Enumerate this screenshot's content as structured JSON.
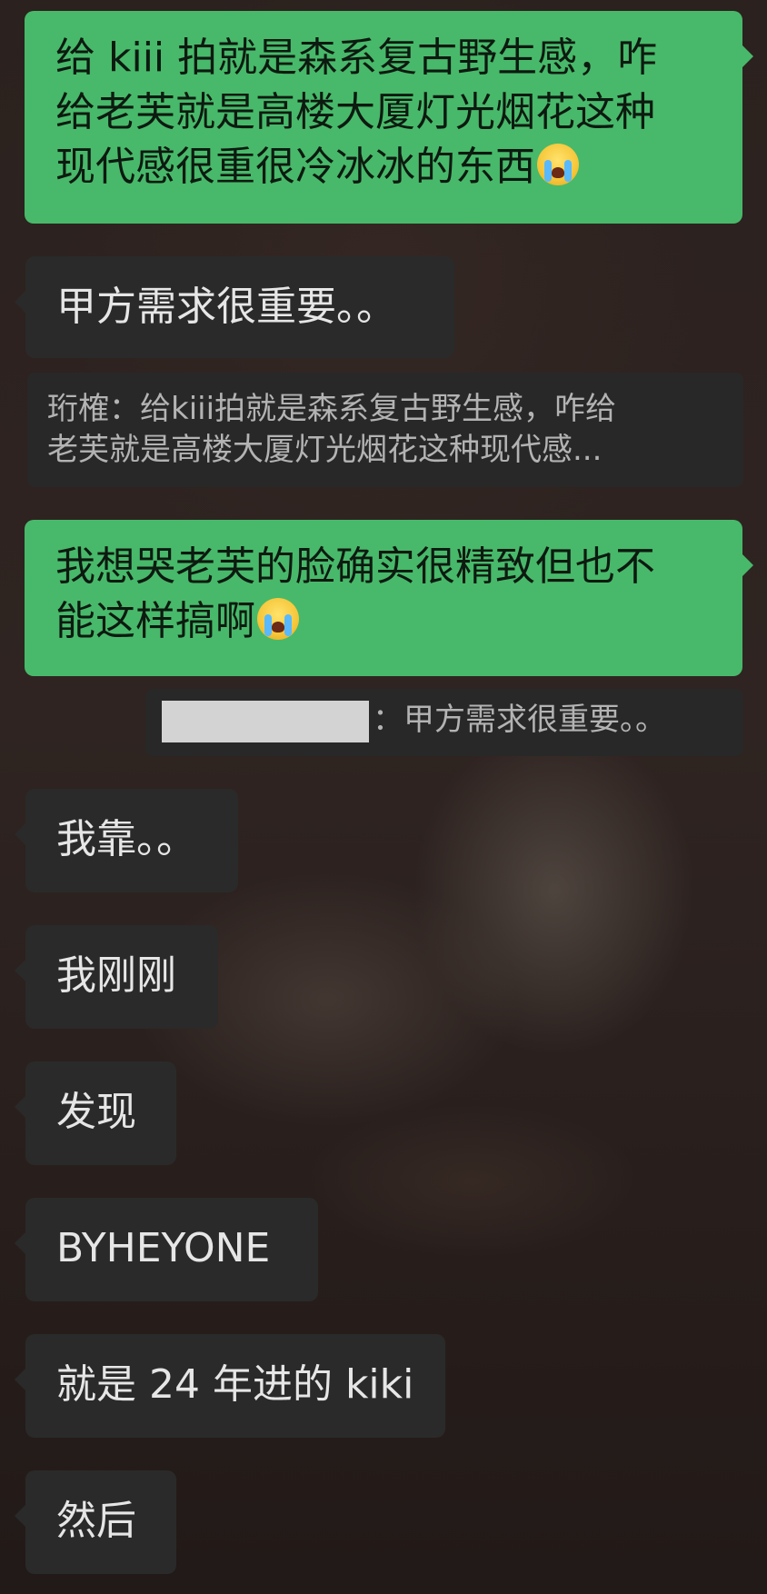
{
  "messages": [
    {
      "type": "sent",
      "lines": [
        "给 kiii 拍就是森系复古野生感，咋",
        "给老芙就是高楼大厦灯光烟花这种",
        "现代感很重很冷冰冰的东西"
      ],
      "emoji": "loudly-crying-face-emoji"
    },
    {
      "type": "received",
      "text": "甲方需求很重要。。"
    },
    {
      "type": "quote",
      "lines": [
        "珩榷：给kiii拍就是森系复古野生感，咋给",
        "老芙就是高楼大厦灯光烟花这种现代感..."
      ]
    },
    {
      "type": "sent",
      "lines": [
        "我想哭老芙的脸确实很精致但也不",
        "能这样搞啊"
      ],
      "emoji": "loudly-crying-face-emoji"
    },
    {
      "type": "quote",
      "text": "：甲方需求很重要。。",
      "redacted": true
    },
    {
      "type": "received",
      "text": "我靠。。"
    },
    {
      "type": "received",
      "text": "我刚刚"
    },
    {
      "type": "received",
      "text": "发现"
    },
    {
      "type": "received",
      "text": "BYHEYONE"
    },
    {
      "type": "received",
      "text": "就是 24 年进的 kiki"
    },
    {
      "type": "received",
      "text": "然后"
    }
  ],
  "colors": {
    "sent_bubble": "#48b96a",
    "received_bubble": "#2a2a2a",
    "quote_bg": "#282828"
  }
}
